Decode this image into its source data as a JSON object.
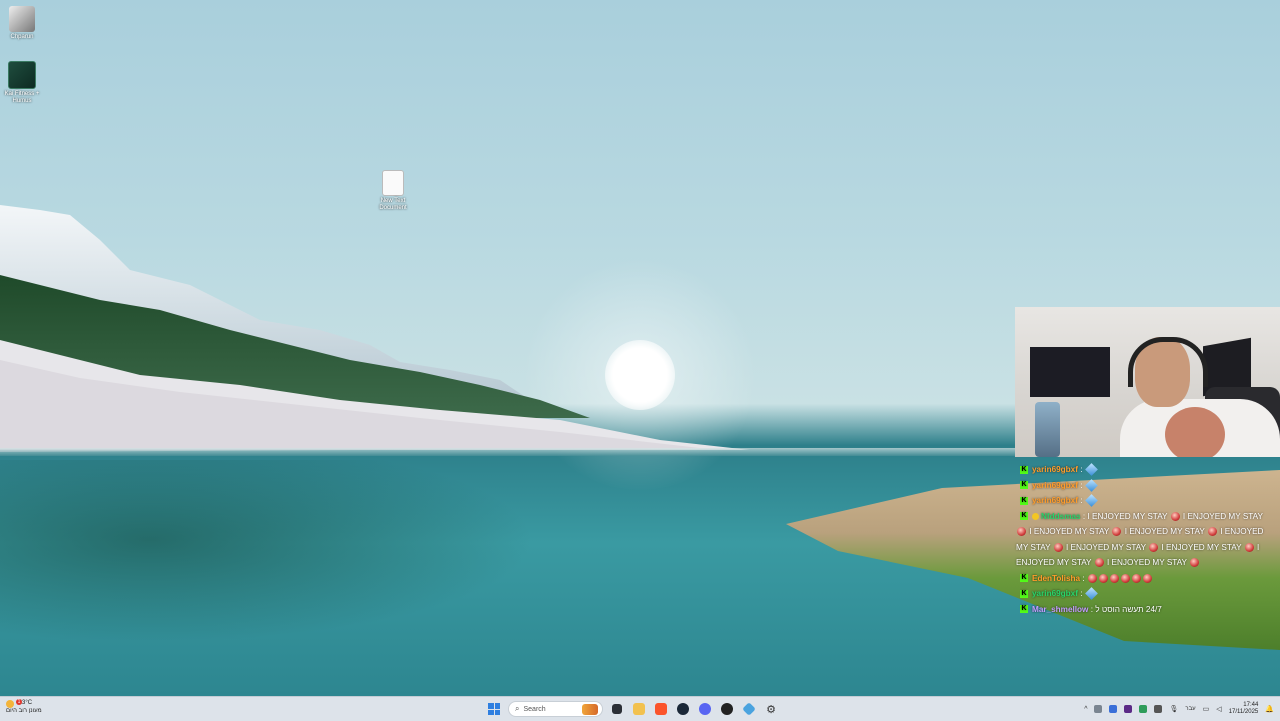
{
  "desktop": {
    "icons": [
      {
        "label": "Chparun"
      },
      {
        "label": "Kai Fitness +\nHumus"
      },
      {
        "label": "New Text\nDocument"
      }
    ]
  },
  "chat": {
    "messages": [
      {
        "user": "yarin69gbxf",
        "text": "",
        "emotes": "blue"
      },
      {
        "user": "yarin69gbxf",
        "text": "",
        "emotes": "blue"
      },
      {
        "user": "yarin69gbxf",
        "text": "",
        "emotes": "blue"
      },
      {
        "user": "Nfddsmas",
        "text": "I ENJOYED MY STAY",
        "emotes": "spam"
      },
      {
        "user": "EdenTolisha",
        "text": "",
        "emotes": "red6"
      },
      {
        "user": "yarin69gbxf",
        "text": "",
        "emotes": "blue"
      },
      {
        "user": "Mar_shmellow",
        "text": "24/7 תעשה הוסט ל"
      }
    ],
    "spam_text": "I ENJOYED MY STAY",
    "separator": ":"
  },
  "taskbar": {
    "weather_temp": "23°C",
    "weather_desc": "מעונן רוב היום",
    "weather_alert": "1",
    "search_placeholder": "Search",
    "language": "עבר",
    "time": "17:44",
    "date": "17/11/2025"
  },
  "colors": {
    "kick_green": "#53fc18",
    "taskbar_bg": "#dde3ea"
  }
}
